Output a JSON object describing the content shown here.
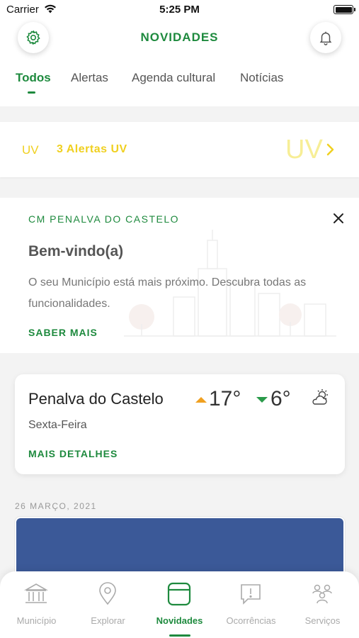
{
  "status_bar": {
    "carrier": "Carrier",
    "time": "5:25 PM"
  },
  "header": {
    "title": "NOVIDADES",
    "settings_icon": "gear-icon",
    "notifications_icon": "bell-icon"
  },
  "tabs": [
    {
      "label": "Todos",
      "active": true
    },
    {
      "label": "Alertas",
      "active": false
    },
    {
      "label": "Agenda cultural",
      "active": false
    },
    {
      "label": "Notícias",
      "active": false
    }
  ],
  "uv_alert": {
    "badge": "UV",
    "text": "3 Alertas UV",
    "watermark": "UV",
    "color": "#f0d020"
  },
  "welcome": {
    "organization": "CM PENALVA DO CASTELO",
    "title": "Bem-vindo(a)",
    "description": "O seu Município está mais próximo. Descubra todas as funcionalidades.",
    "link": "SABER MAIS"
  },
  "weather": {
    "city": "Penalva do Castelo",
    "day": "Sexta-Feira",
    "max_temp": "17°",
    "min_temp": "6°",
    "icon": "partly-cloudy-icon",
    "link": "MAIS DETALHES"
  },
  "feed": {
    "date": "26 MARÇO, 2021"
  },
  "bottom_nav": [
    {
      "label": "Município",
      "icon": "building-icon",
      "active": false
    },
    {
      "label": "Explorar",
      "icon": "map-pin-icon",
      "active": false
    },
    {
      "label": "Novidades",
      "icon": "news-icon",
      "active": true
    },
    {
      "label": "Ocorrências",
      "icon": "alert-message-icon",
      "active": false
    },
    {
      "label": "Serviços",
      "icon": "services-icon",
      "active": false
    }
  ],
  "colors": {
    "accent": "#1e8a3e",
    "uv_yellow": "#f0d020",
    "news_image": "#3b5998"
  }
}
